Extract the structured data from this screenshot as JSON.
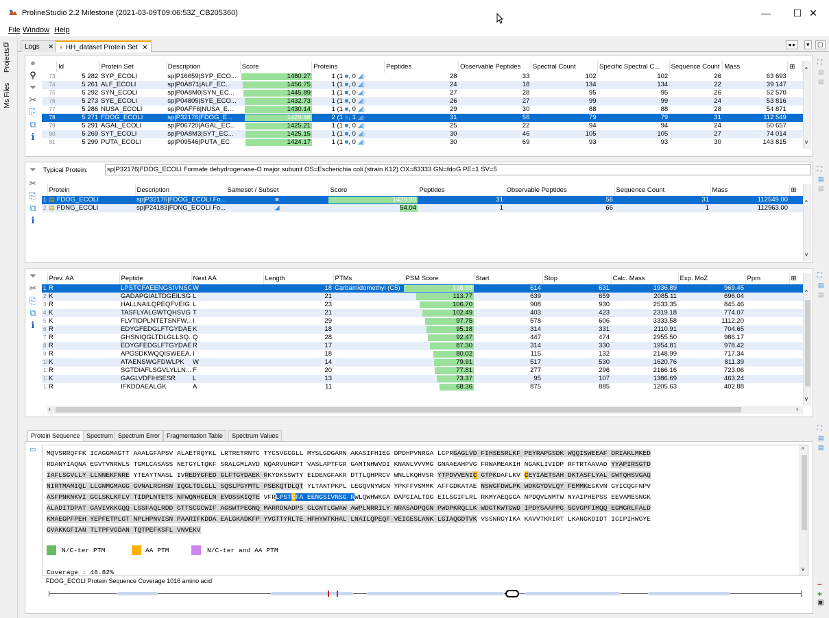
{
  "window": {
    "title": "ProlineStudio 2.2 Milestone (2021-03-09T09:06:53Z_CB205360)",
    "min": "—",
    "max": "☐",
    "close": "✕"
  },
  "menu": [
    "File",
    "Window",
    "Help"
  ],
  "left_tabs": [
    "Projects",
    "Ms Files"
  ],
  "tabs": {
    "logs": "Logs",
    "dataset": "HH_dataset Protein Set"
  },
  "protein_sets": {
    "columns": [
      "Id",
      "Protein Set",
      "Description",
      "Score",
      "Proteins",
      "Peptides",
      "Observable Peptides",
      "Spectral Count",
      "Specific Spectral C...",
      "Sequence Count",
      "Mass"
    ],
    "rows": [
      {
        "n": "73",
        "id": "5 282",
        "set": "SYP_ECOLI",
        "desc": "sp|P16659|SYP_ECO...",
        "score": "1480.27",
        "prot": "1 (1",
        "prot2": ", 0",
        "pep": "28",
        "obs": "33",
        "sc": "102",
        "ssc": "102",
        "seq": "26",
        "mass": "63 693",
        "bar": 0.98
      },
      {
        "n": "74",
        "id": "5 261",
        "set": "ALF_ECOLI",
        "desc": "sp|P0A871|ALF_EC...",
        "score": "1456.75",
        "prot": "1 (1",
        "prot2": ", 0",
        "pep": "24",
        "obs": "18",
        "sc": "134",
        "ssc": "134",
        "seq": "22",
        "mass": "39 147",
        "bar": 0.96
      },
      {
        "n": "75",
        "id": "5 292",
        "set": "SYN_ECOLI",
        "desc": "sp|P0A8M0|SYN_EC...",
        "score": "1445.89",
        "prot": "1 (1",
        "prot2": ", 0",
        "pep": "27",
        "obs": "28",
        "sc": "95",
        "ssc": "95",
        "seq": "26",
        "mass": "52 570",
        "bar": 0.95
      },
      {
        "n": "76",
        "id": "5 273",
        "set": "SYE_ECOLI",
        "desc": "sp|P04805|SYE_ECO...",
        "score": "1432.73",
        "prot": "1 (1",
        "prot2": ", 0",
        "pep": "26",
        "obs": "27",
        "sc": "99",
        "ssc": "99",
        "seq": "24",
        "mass": "53 816",
        "bar": 0.94
      },
      {
        "n": "77",
        "id": "5 286",
        "set": "NUSA_ECOLI",
        "desc": "sp|P0AFF6|NUSA_E...",
        "score": "1430.14",
        "prot": "1 (1",
        "prot2": ", 0",
        "pep": "29",
        "obs": "30",
        "sc": "88",
        "ssc": "88",
        "seq": "28",
        "mass": "54 871",
        "bar": 0.94
      },
      {
        "n": "78",
        "id": "5 271",
        "set": "FDOG_ECOLI",
        "desc": "sp|P32176|FDOG_E...",
        "score": "1429.98",
        "prot": "2 (1",
        "prot2": ", 1",
        "pep": "31",
        "obs": "56",
        "sc": "79",
        "ssc": "79",
        "seq": "31",
        "mass": "112 549",
        "bar": 0.94,
        "sel": true
      },
      {
        "n": "79",
        "id": "5 291",
        "set": "AGAL_ECOLI",
        "desc": "sp|P06720|AGAL_EC...",
        "score": "1425.21",
        "prot": "1 (1",
        "prot2": ", 0",
        "pep": "25",
        "obs": "22",
        "sc": "94",
        "ssc": "94",
        "seq": "24",
        "mass": "50 657",
        "bar": 0.93
      },
      {
        "n": "80",
        "id": "5 269",
        "set": "SYT_ECOLI",
        "desc": "sp|P0A8M3|SYT_EC...",
        "score": "1425.15",
        "prot": "1 (1",
        "prot2": ", 0",
        "pep": "30",
        "obs": "46",
        "sc": "105",
        "ssc": "105",
        "seq": "27",
        "mass": "74 014",
        "bar": 0.93
      },
      {
        "n": "81",
        "id": "5 299",
        "set": "PUTA_ECOLI",
        "desc": "sp|P09546|PUTA_EC",
        "score": "1424.17",
        "prot": "1 (1",
        "prot2": ", 0",
        "pep": "30",
        "obs": "69",
        "sc": "93",
        "ssc": "93",
        "seq": "30",
        "mass": "143 815",
        "bar": 0.93
      }
    ]
  },
  "typical": {
    "label": "Typical Protein:",
    "value": "sp|P32176|FDOG_ECOLI Formate dehydrogenase-O major subunit OS=Escherichia coli (strain K12) OX=83333 GN=fdoG PE=1 SV=5"
  },
  "proteins": {
    "columns": [
      "Protein",
      "Description",
      "Sameset / Subset",
      "Score",
      "Peptides",
      "Observable Peptides",
      "Sequence Count",
      "Mass"
    ],
    "rows": [
      {
        "n": "1",
        "prot": "FDOG_ECOLI",
        "desc": "sp|P32176|FDOG_ECOLI Fo...",
        "score": "1429.98",
        "pep": "31",
        "obs": "56",
        "seq": "31",
        "mass": "112549.00",
        "bar": 1.0,
        "sel": true
      },
      {
        "n": "2",
        "prot": "FDNG_ECOLI",
        "desc": "sp|P24183|FDNG_ECOLI Fo...",
        "score": "54.04",
        "pep": "1",
        "obs": "66",
        "seq": "1",
        "mass": "112963.00",
        "bar": 0.2
      }
    ]
  },
  "peptides": {
    "columns": [
      "Prev. AA",
      "Peptide",
      "Next AA",
      "Length",
      "PTMs",
      "PSM Score",
      "Start",
      "Stop",
      "Calc. Mass",
      "Exp. MoZ",
      "Ppm"
    ],
    "rows": [
      {
        "n": "1",
        "prev": "R",
        "pep": "LPSTCFAEENGSIVNSGR",
        "next": "W",
        "len": "18",
        "ptm": "Carbamidomethyl (C5)",
        "score": "138.99",
        "start": "614",
        "stop": "631",
        "calc": "1936.89",
        "exp": "969.45",
        "bar": 1.0,
        "sel": true
      },
      {
        "n": "2",
        "prev": "K",
        "pep": "GADAPGIALTDGEILSG...",
        "next": "L",
        "len": "21",
        "ptm": "",
        "score": "113.77",
        "start": "639",
        "stop": "659",
        "calc": "2085.11",
        "exp": "696.04",
        "bar": 0.82
      },
      {
        "n": "3",
        "prev": "R",
        "pep": "HALLNAILQPEQFVEIG...",
        "next": "L",
        "len": "23",
        "ptm": "",
        "score": "106.70",
        "start": "908",
        "stop": "930",
        "calc": "2533.35",
        "exp": "845.46",
        "bar": 0.77
      },
      {
        "n": "4",
        "prev": "K",
        "pep": "TASFLYALGWTQHSVG...",
        "next": "T",
        "len": "21",
        "ptm": "",
        "score": "102.49",
        "start": "403",
        "stop": "423",
        "calc": "2319.18",
        "exp": "774.07",
        "bar": 0.74
      },
      {
        "n": "5",
        "prev": "K",
        "pep": "FLVTIDPLNTETSNFW...",
        "next": "I",
        "len": "29",
        "ptm": "",
        "score": "97.75",
        "start": "578",
        "stop": "606",
        "calc": "3333.58",
        "exp": "1112.20",
        "bar": 0.7
      },
      {
        "n": "6",
        "prev": "R",
        "pep": "EDYGFEDGLFTGYDAEKR",
        "next": "K",
        "len": "18",
        "ptm": "",
        "score": "95.18",
        "start": "314",
        "stop": "331",
        "calc": "2110.91",
        "exp": "704.65",
        "bar": 0.68
      },
      {
        "n": "7",
        "prev": "R",
        "pep": "GHSNIQGLTDLGLLSQ...",
        "next": "Q",
        "len": "28",
        "ptm": "",
        "score": "92.47",
        "start": "447",
        "stop": "474",
        "calc": "2955.50",
        "exp": "986.17",
        "bar": 0.66
      },
      {
        "n": "8",
        "prev": "R",
        "pep": "EDYGFEDGLFTGYDAEK",
        "next": "R",
        "len": "17",
        "ptm": "",
        "score": "87.30",
        "start": "314",
        "stop": "330",
        "calc": "1954.81",
        "exp": "978.42",
        "bar": 0.63
      },
      {
        "n": "9",
        "prev": "R",
        "pep": "APGSDKWQQISWEEA...",
        "next": "I",
        "len": "18",
        "ptm": "",
        "score": "80.02",
        "start": "115",
        "stop": "132",
        "calc": "2148.99",
        "exp": "717.34",
        "bar": 0.58
      },
      {
        "n": "10",
        "prev": "K",
        "pep": "ATAENSWGFDWLPK",
        "next": "W",
        "len": "14",
        "ptm": "",
        "score": "79.91",
        "start": "517",
        "stop": "530",
        "calc": "1620.76",
        "exp": "811.39",
        "bar": 0.57
      },
      {
        "n": "11",
        "prev": "R",
        "pep": "SGTDIAFLSGVLYLLN...",
        "next": "F",
        "len": "20",
        "ptm": "",
        "score": "77.81",
        "start": "277",
        "stop": "296",
        "calc": "2166.16",
        "exp": "723.06",
        "bar": 0.56
      },
      {
        "n": "12",
        "prev": "K",
        "pep": "GAGLVDFIHSESR",
        "next": "L",
        "len": "13",
        "ptm": "",
        "score": "73.37",
        "start": "95",
        "stop": "107",
        "calc": "1386.69",
        "exp": "463.24",
        "bar": 0.53
      },
      {
        "n": "13",
        "prev": "R",
        "pep": "IFKDDAEALGK",
        "next": "A",
        "len": "11",
        "ptm": "",
        "score": "68.36",
        "start": "875",
        "stop": "885",
        "calc": "1205.63",
        "exp": "402.88",
        "bar": 0.49
      }
    ]
  },
  "bottom_tabs": [
    "Protein Sequence",
    "Spectrum",
    "Spectrum Error",
    "Fragmentation Table",
    "Spectrum Values"
  ],
  "legend": {
    "nc": "N/C-ter PTM",
    "aa": "AA PTM",
    "both": "N/C-ter and AA PTM",
    "nc_color": "#66bb66",
    "aa_color": "#ffb300",
    "both_color": "#cc88ee"
  },
  "coverage": "Coverage : 48.82%",
  "coverage_title": "FDOG_ECOLI Protein Sequence Coverage 1016 amino acid"
}
